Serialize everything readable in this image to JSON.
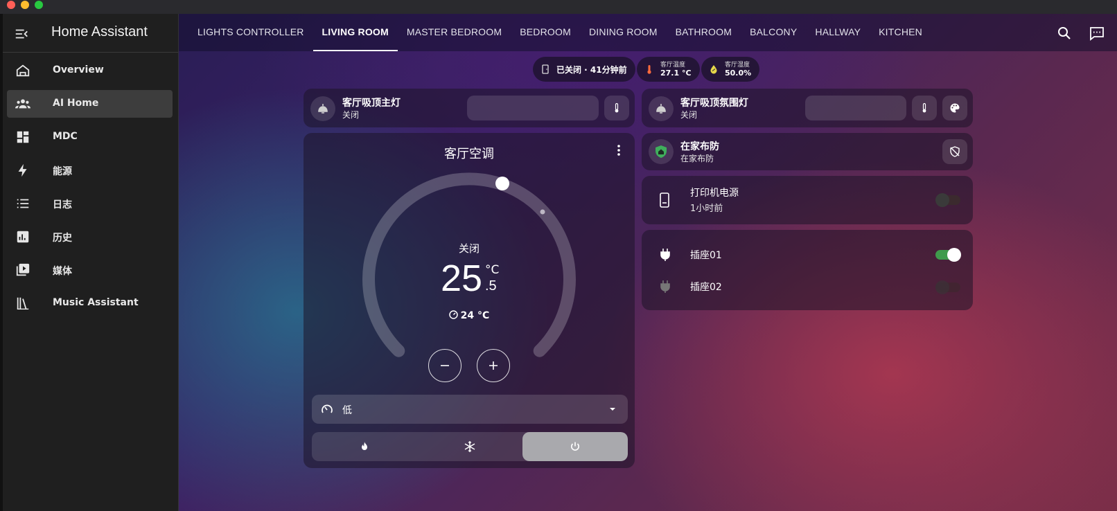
{
  "app": {
    "title": "Home Assistant"
  },
  "sidebar": {
    "items": [
      {
        "label": "Overview",
        "icon": "home-icon"
      },
      {
        "label": "AI Home",
        "icon": "people-icon",
        "active": true
      },
      {
        "label": "MDC",
        "icon": "dashboard-icon"
      },
      {
        "label": "能源",
        "icon": "lightning-icon"
      },
      {
        "label": "日志",
        "icon": "list-icon"
      },
      {
        "label": "历史",
        "icon": "chart-icon"
      },
      {
        "label": "媒体",
        "icon": "media-icon"
      },
      {
        "label": "Music Assistant",
        "icon": "library-icon"
      }
    ]
  },
  "tabs": [
    {
      "label": "LIGHTS CONTROLLER"
    },
    {
      "label": "LIVING ROOM",
      "active": true
    },
    {
      "label": "MASTER BEDROOM"
    },
    {
      "label": "BEDROOM"
    },
    {
      "label": "DINING ROOM"
    },
    {
      "label": "BATHROOM"
    },
    {
      "label": "BALCONY"
    },
    {
      "label": "HALLWAY"
    },
    {
      "label": "KITCHEN"
    }
  ],
  "badges": {
    "door": {
      "text": "已关闭 · 41分钟前"
    },
    "temp": {
      "label": "客厅温度",
      "value": "27.1 °C",
      "color": "#ff6b3d"
    },
    "humidity": {
      "label": "客厅湿度",
      "value": "50.0%",
      "color": "#e6d84a"
    }
  },
  "lights": {
    "main": {
      "name": "客厅吸顶主灯",
      "state": "关闭"
    },
    "ambient": {
      "name": "客厅吸顶氛围灯",
      "state": "关闭"
    }
  },
  "climate": {
    "name": "客厅空调",
    "state": "关闭",
    "target_int": "25",
    "target_dec": ".5",
    "unit": "°C",
    "current": "24 °C",
    "fan_mode": "低",
    "modes": [
      "heat",
      "cool",
      "off"
    ],
    "active_mode": "off"
  },
  "alarm": {
    "name": "在家布防",
    "state": "在家布防",
    "color": "#3fae5c"
  },
  "printer": {
    "name": "打印机电源",
    "time": "1小时前",
    "on": false
  },
  "sockets": [
    {
      "name": "插座01",
      "on": true
    },
    {
      "name": "插座02",
      "on": false
    }
  ],
  "colors": {
    "accent": "#3f9b4c",
    "sidebar": "#1f1f1f"
  }
}
